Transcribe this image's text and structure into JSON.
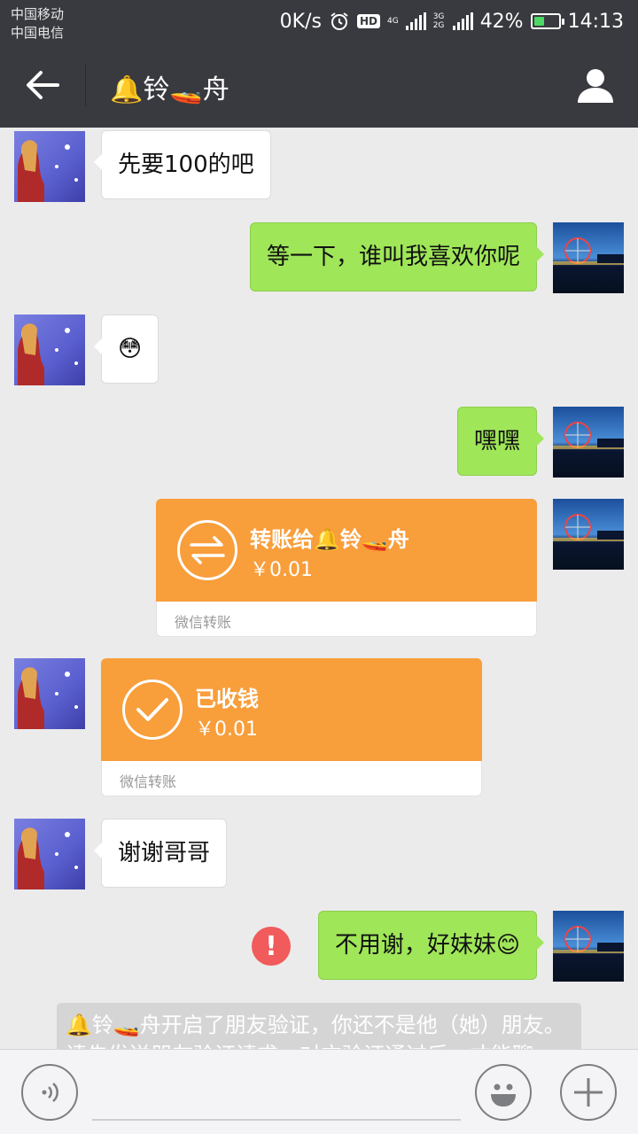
{
  "status_bar": {
    "carrier1": "中国移动",
    "carrier2": "中国电信",
    "net_speed": "0K/s",
    "hd_label": "HD",
    "net_label_a": "4G",
    "net_label_b": "3G 2G",
    "battery_percent": "42%",
    "battery_level": 0.42,
    "time": "14:13"
  },
  "header": {
    "title": "🔔铃🚤舟",
    "back_icon": "arrow-left-icon",
    "profile_icon": "person-icon"
  },
  "messages": [
    {
      "side": "in",
      "type": "text",
      "text": "先要100的吧"
    },
    {
      "side": "out",
      "type": "text",
      "text": "等一下，谁叫我喜欢你呢"
    },
    {
      "side": "in",
      "type": "emoji",
      "text": "😳"
    },
    {
      "side": "out",
      "type": "text",
      "text": "嘿嘿"
    },
    {
      "side": "out",
      "type": "transfer",
      "title": "转账给🔔铃🚤舟",
      "amount": "￥0.01",
      "footer": "微信转账"
    },
    {
      "side": "in",
      "type": "transfer-received",
      "title": "已收钱",
      "amount": "￥0.01",
      "footer": "微信转账"
    },
    {
      "side": "in",
      "type": "text",
      "text": "谢谢哥哥"
    },
    {
      "side": "out",
      "type": "text",
      "text": "不用谢，好妹妹😊",
      "failed": true,
      "failed_mark": "!"
    }
  ],
  "system_message": "🔔铃🚤舟开启了朋友验证，你还不是他（她）朋友。请先发送朋友验证请求，对方验证通过后，才能聊天。",
  "input_bar": {
    "voice_icon": "voice-icon",
    "emoji_icon": "smiley-icon",
    "plus_icon": "plus-icon",
    "text_value": ""
  },
  "colors": {
    "header_bg": "#393a3f",
    "chat_bg": "#ebebeb",
    "bubble_out": "#9fe658",
    "bubble_in": "#ffffff",
    "transfer": "#f89e3b",
    "error": "#f15b5b"
  }
}
